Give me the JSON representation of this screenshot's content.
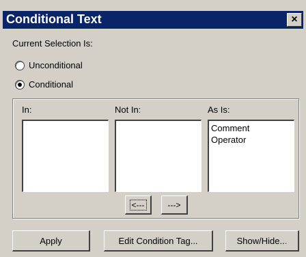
{
  "window": {
    "title": "Conditional Text",
    "close_glyph": "×",
    "close_icon": "close-icon"
  },
  "selection_label": "Current Selection Is:",
  "radios": {
    "unconditional": {
      "label": "Unconditional",
      "checked": false
    },
    "conditional": {
      "label": "Conditional",
      "checked": true
    }
  },
  "lists": {
    "in": {
      "label": "In:",
      "items": []
    },
    "not_in": {
      "label": "Not In:",
      "items": []
    },
    "as_is": {
      "label": "As Is:",
      "items": [
        "Comment",
        "Operator"
      ]
    }
  },
  "move_buttons": {
    "left": "<---",
    "right": "--->"
  },
  "footer": {
    "apply": "Apply",
    "edit": "Edit Condition Tag...",
    "show_hide": "Show/Hide..."
  },
  "colors": {
    "titlebar": "#0a246a",
    "face": "#d4d0c8"
  }
}
